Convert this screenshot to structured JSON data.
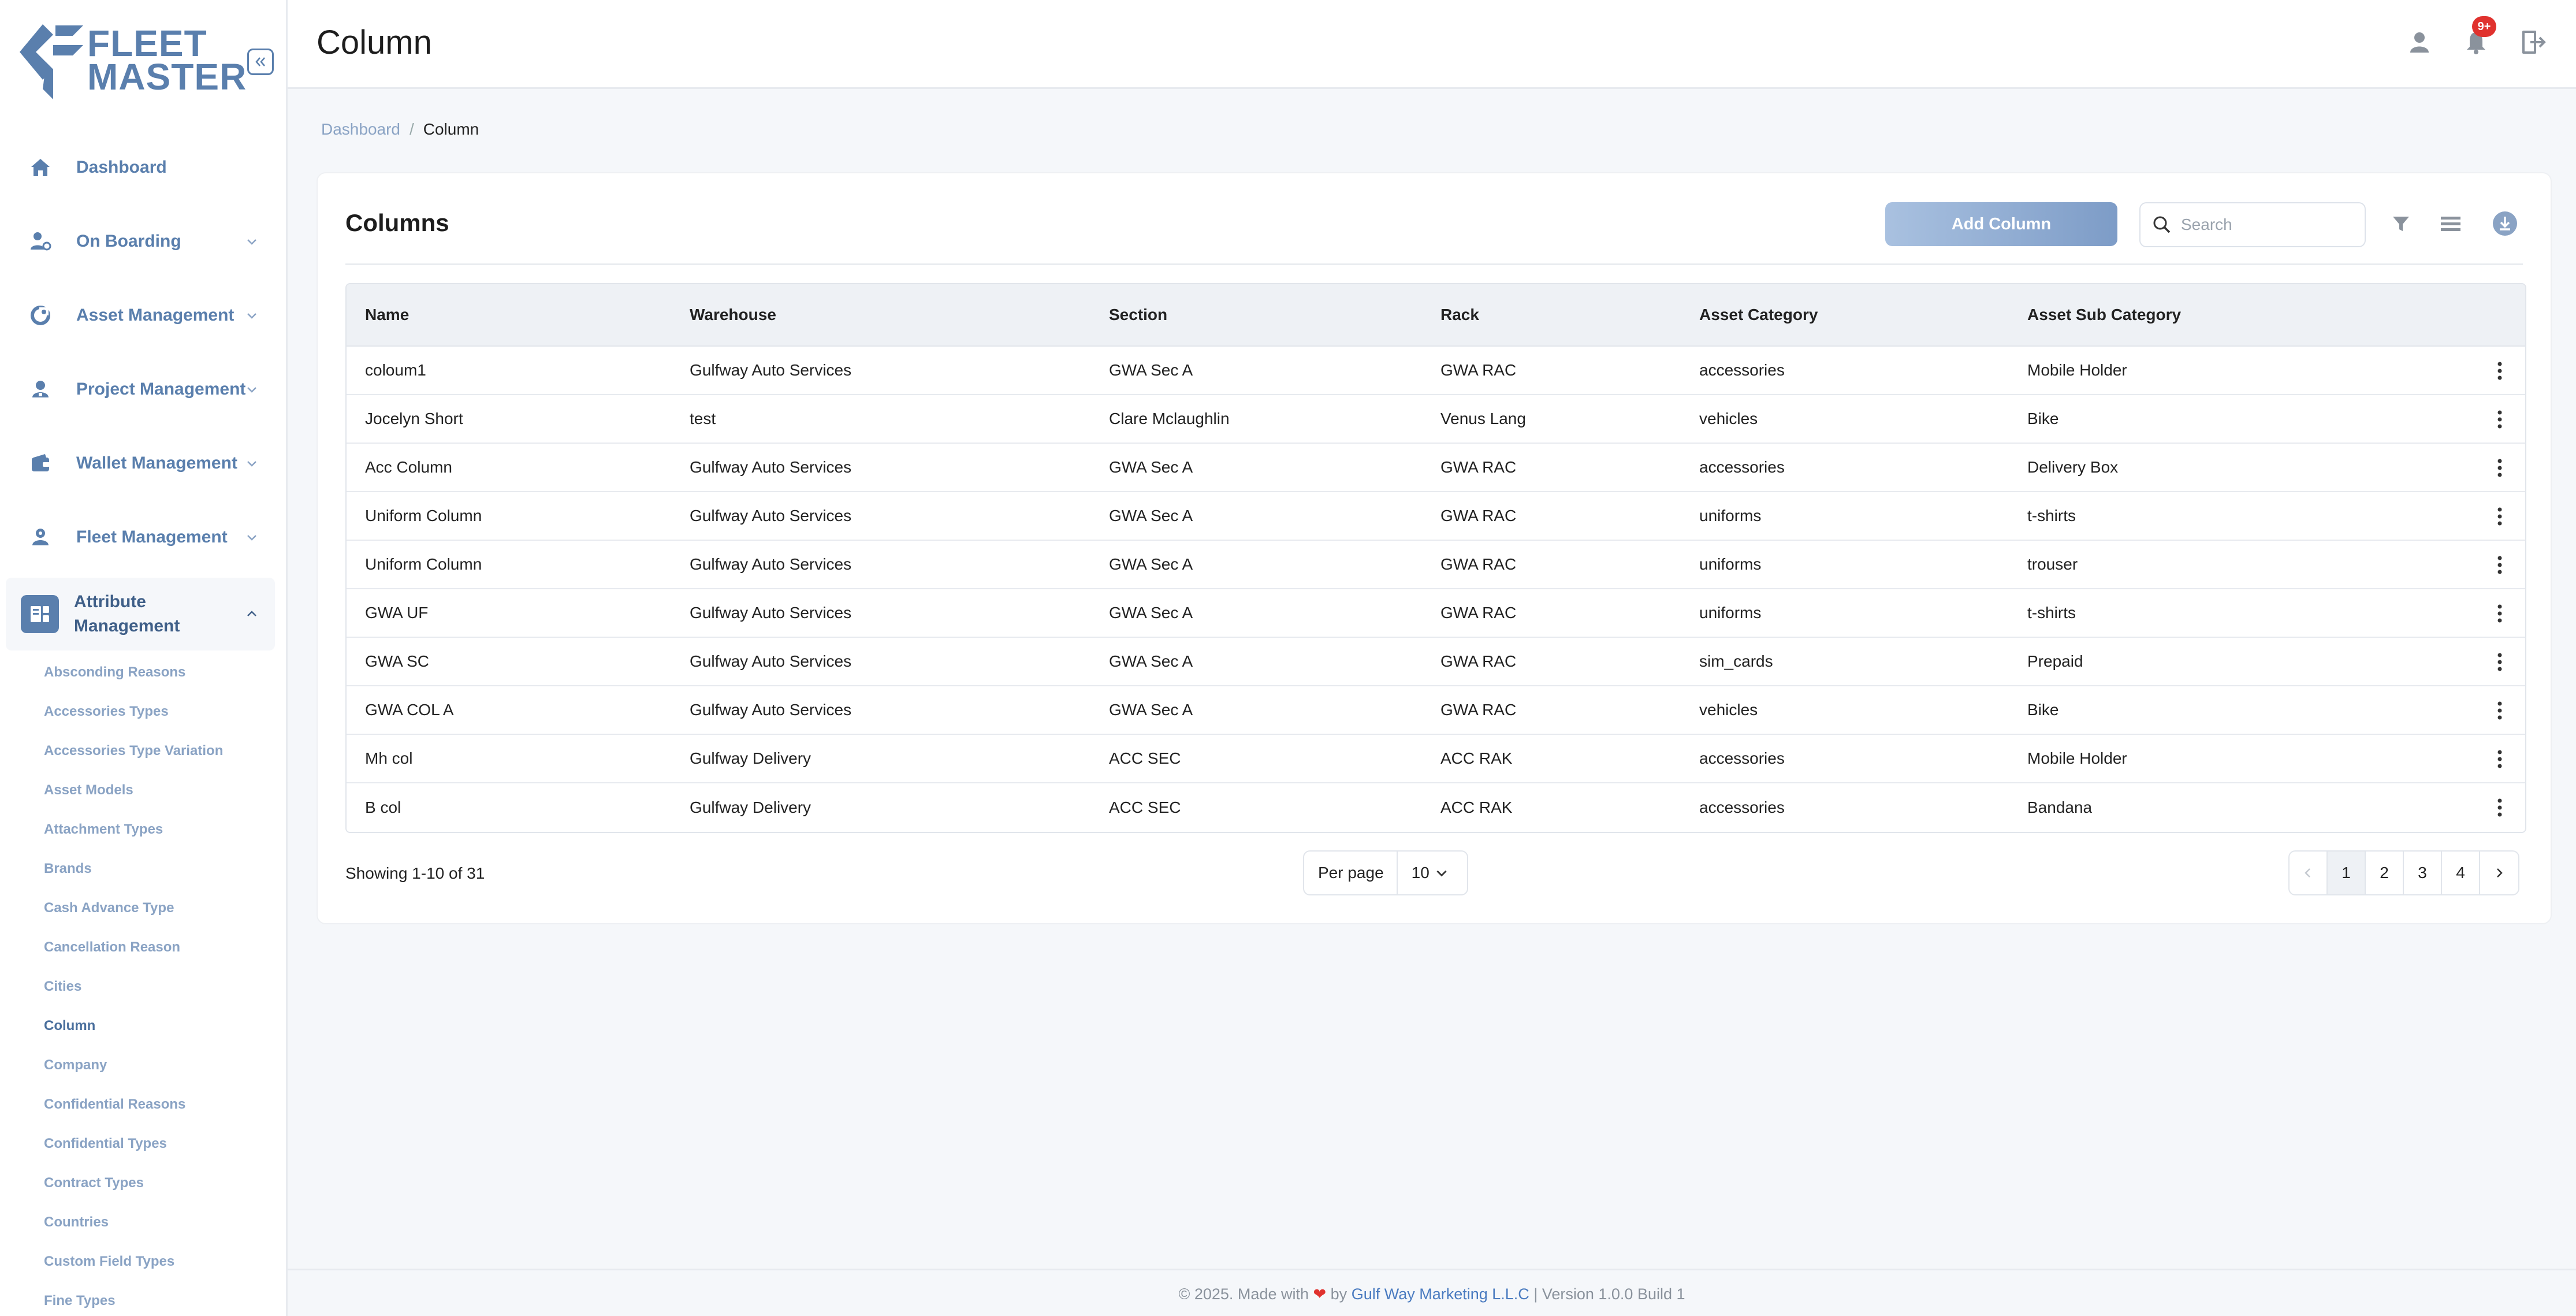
{
  "brand": {
    "line1": "FLEET",
    "line2": "MASTER",
    "color": "#5a7fad"
  },
  "sidebar": {
    "items": [
      {
        "label": "Dashboard",
        "icon": "home-icon"
      },
      {
        "label": "On Boarding",
        "icon": "onboarding-icon"
      },
      {
        "label": "Asset Management",
        "icon": "asset-icon"
      },
      {
        "label": "Project Management",
        "icon": "project-icon"
      },
      {
        "label": "Wallet Management",
        "icon": "wallet-icon"
      },
      {
        "label": "Fleet Management",
        "icon": "fleet-icon"
      }
    ],
    "active_group": {
      "line1": "Attribute",
      "line2": "Management",
      "icon": "attribute-icon"
    },
    "sub_items": [
      "Absconding Reasons",
      "Accessories Types",
      "Accessories Type Variation",
      "Asset Models",
      "Attachment Types",
      "Brands",
      "Cash Advance Type",
      "Cancellation Reason",
      "Cities",
      "Column",
      "Company",
      "Confidential Reasons",
      "Confidential Types",
      "Contract Types",
      "Countries",
      "Custom Field Types",
      "Fine Types"
    ],
    "active_sub": "Column"
  },
  "header": {
    "title": "Column",
    "notification_badge": "9+"
  },
  "breadcrumb": {
    "root": "Dashboard",
    "separator": "/",
    "current": "Column"
  },
  "card": {
    "title": "Columns",
    "add_label": "Add Column",
    "search_placeholder": "Search"
  },
  "table": {
    "headers": [
      "Name",
      "Warehouse",
      "Section",
      "Rack",
      "Asset Category",
      "Asset Sub Category"
    ],
    "rows": [
      [
        "coloum1",
        "Gulfway Auto Services",
        "GWA Sec A",
        "GWA RAC",
        "accessories",
        "Mobile Holder"
      ],
      [
        "Jocelyn Short",
        "test",
        "Clare Mclaughlin",
        "Venus Lang",
        "vehicles",
        "Bike"
      ],
      [
        "Acc Column",
        "Gulfway Auto Services",
        "GWA Sec A",
        "GWA RAC",
        "accessories",
        "Delivery Box"
      ],
      [
        "Uniform Column",
        "Gulfway Auto Services",
        "GWA Sec A",
        "GWA RAC",
        "uniforms",
        "t-shirts"
      ],
      [
        "Uniform Column",
        "Gulfway Auto Services",
        "GWA Sec A",
        "GWA RAC",
        "uniforms",
        "trouser"
      ],
      [
        "GWA UF",
        "Gulfway Auto Services",
        "GWA Sec A",
        "GWA RAC",
        "uniforms",
        "t-shirts"
      ],
      [
        "GWA SC",
        "Gulfway Auto Services",
        "GWA Sec A",
        "GWA RAC",
        "sim_cards",
        "Prepaid"
      ],
      [
        "GWA COL A",
        "Gulfway Auto Services",
        "GWA Sec A",
        "GWA RAC",
        "vehicles",
        "Bike"
      ],
      [
        "Mh col",
        "Gulfway Delivery",
        "ACC SEC",
        "ACC RAK",
        "accessories",
        "Mobile Holder"
      ],
      [
        "B col",
        "Gulfway Delivery",
        "ACC SEC",
        "ACC RAK",
        "accessories",
        "Bandana"
      ]
    ]
  },
  "pagination": {
    "showing": "Showing 1-10 of 31",
    "per_page_label": "Per page",
    "per_page_value": "10",
    "pages": [
      "1",
      "2",
      "3",
      "4"
    ],
    "current_page": "1"
  },
  "footer": {
    "prefix": "© 2025. Made with",
    "by": "by",
    "company": "Gulf Way Marketing L.L.C",
    "version": "| Version 1.0.0 Build 1"
  }
}
